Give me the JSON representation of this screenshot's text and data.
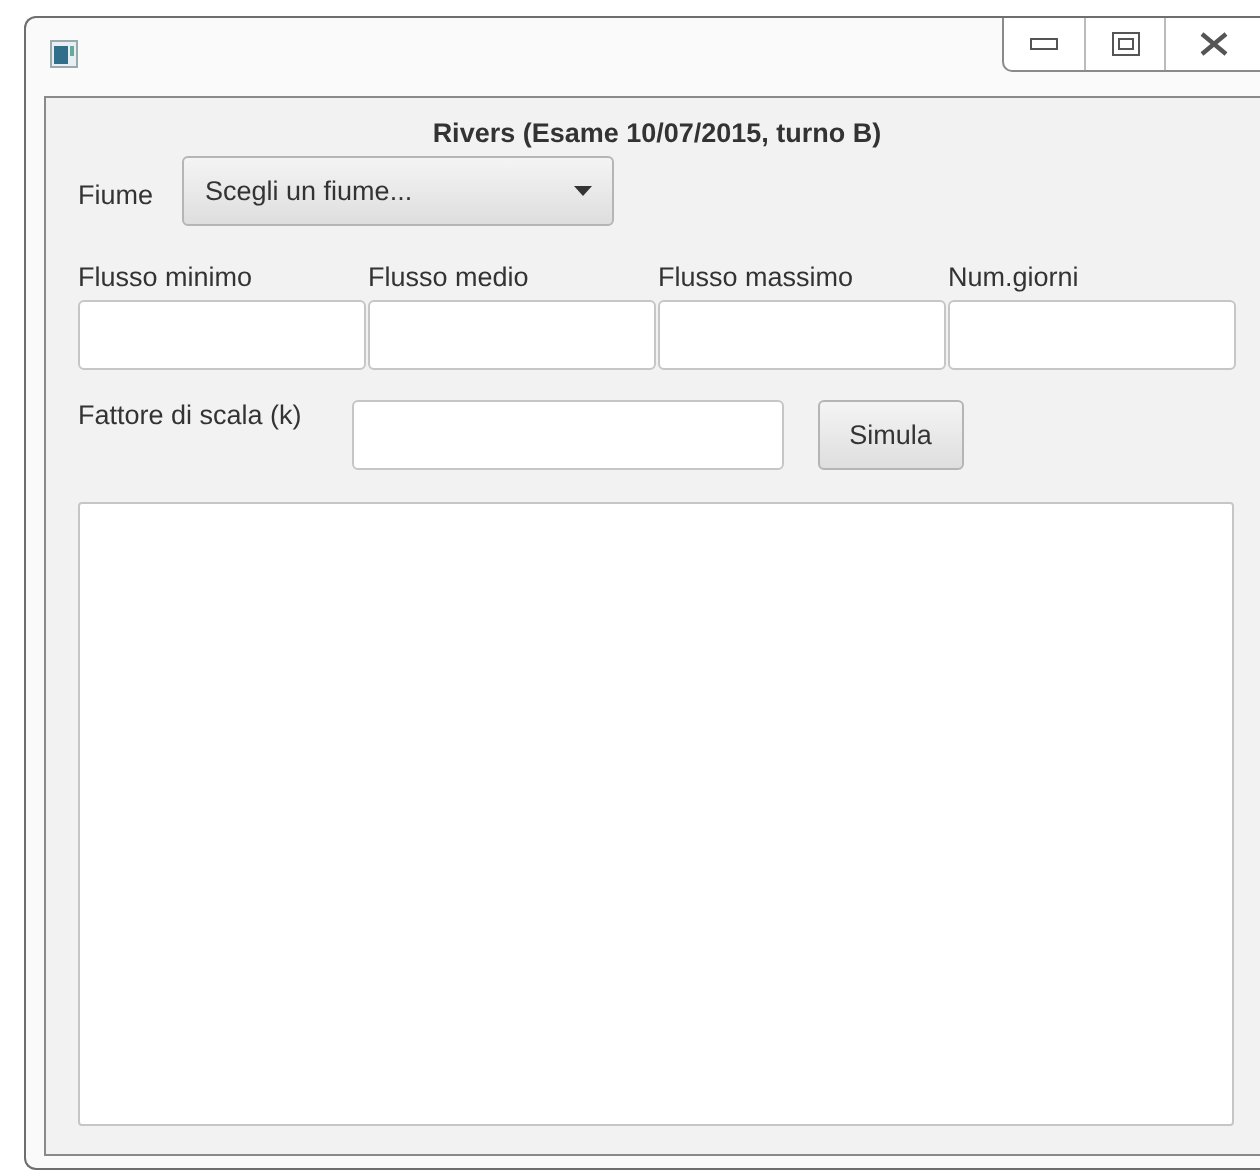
{
  "header": {
    "title": "Rivers (Esame 10/07/2015, turno B)"
  },
  "river": {
    "label": "Fiume",
    "placeholder": "Scegli un fiume..."
  },
  "stats": [
    {
      "label": "Flusso minimo"
    },
    {
      "label": "Flusso medio"
    },
    {
      "label": "Flusso massimo"
    },
    {
      "label": "Num.giorni"
    }
  ],
  "scale": {
    "label": "Fattore di scala (k)"
  },
  "simulate_button": "Simula"
}
